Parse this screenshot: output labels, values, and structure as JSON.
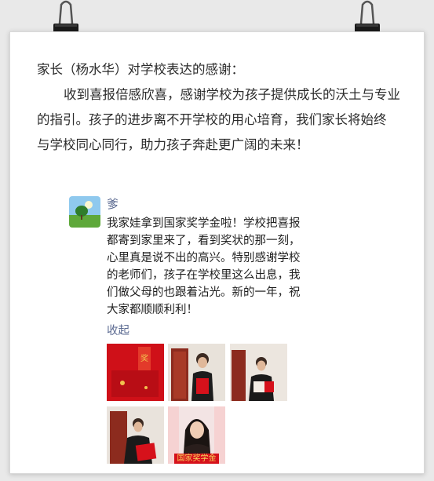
{
  "letter": {
    "heading": "家长（杨水华）对学校表达的感谢：",
    "paragraph_lines": [
      "收到喜报倍感欣喜，感谢学校为孩子提供成长的沃土与专业",
      "的指引。孩子的进步离不开学校的用心培育，我们家长将始终",
      "与学校同心同行，助力孩子奔赴更广阔的未来！"
    ]
  },
  "post": {
    "nickname": "爹",
    "text_lines": [
      "我家娃拿到国家奖学金啦！学校把喜报",
      "都寄到家里来了，看到奖状的那一刻，",
      "心里真是说不出的高兴。特别感谢学校",
      "的老师们，孩子在学校里这么出息，我",
      "们做父母的也跟着沾光。新的一年，祝",
      "大家都顺顺利利！"
    ],
    "collapse_label": "收起",
    "photos": [
      {
        "name": "photo-certificate-red"
      },
      {
        "name": "photo-student-with-certificate-1"
      },
      {
        "name": "photo-student-reading-certificate"
      },
      {
        "name": "photo-student-with-certificate-2"
      },
      {
        "name": "photo-student-girl-banner",
        "banner_text": "国家奖学金"
      }
    ]
  },
  "colors": {
    "link": "#5b6a91",
    "text": "#2b2b2b",
    "accent_red": "#d6111b"
  }
}
